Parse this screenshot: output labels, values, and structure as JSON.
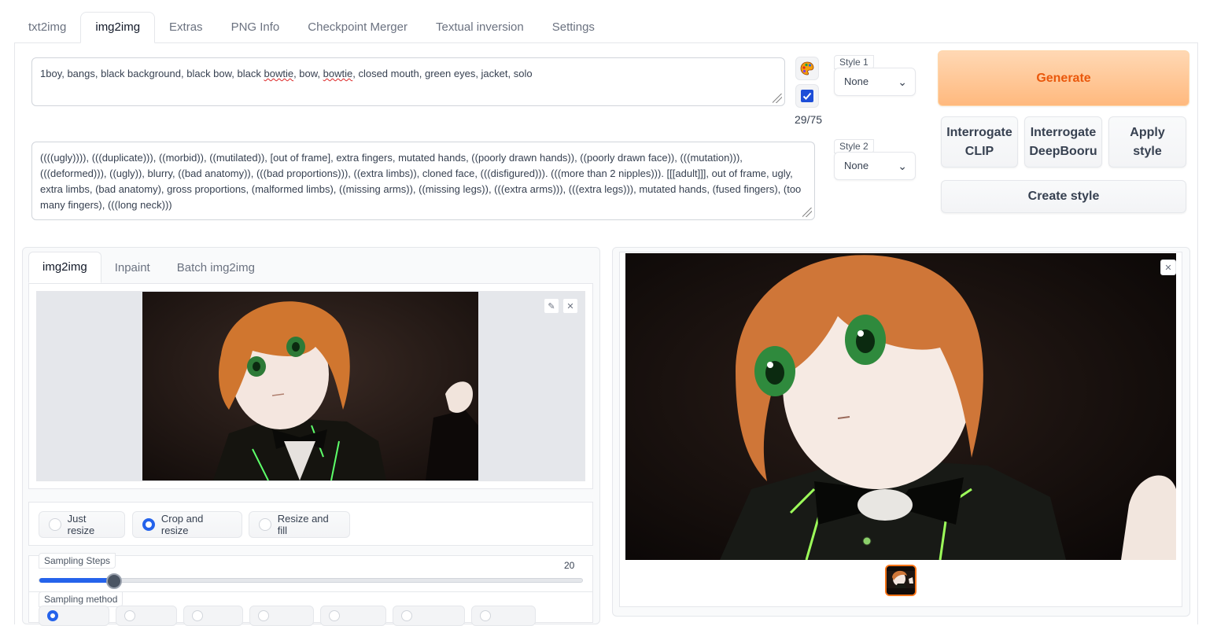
{
  "tabs": [
    "txt2img",
    "img2img",
    "Extras",
    "PNG Info",
    "Checkpoint Merger",
    "Textual inversion",
    "Settings"
  ],
  "prompt": {
    "before1": "1boy, bangs, black background, black bow, black ",
    "word1": "bowtie",
    "between": ", bow, ",
    "word2": "bowtie",
    "after": ", closed mouth, green eyes, jacket, solo"
  },
  "negative_prompt": "((((ugly)))), (((duplicate))), ((morbid)), ((mutilated)), [out of frame], extra fingers, mutated hands, ((poorly drawn hands)), ((poorly drawn face)), (((mutation))), (((deformed))), ((ugly)), blurry, ((bad anatomy)), (((bad proportions))), ((extra limbs)), cloned face, (((disfigured))). (((more than 2 nipples))). [[[adult]]], out of frame, ugly, extra limbs, (bad anatomy), gross proportions, (malformed limbs), ((missing arms)), ((missing legs)), (((extra arms))), (((extra legs))), mutated hands, (fused fingers), (too many fingers), (((long neck)))",
  "token_count": "29/75",
  "icons": {
    "paint": "palette-icon",
    "check": "checkbox-icon"
  },
  "style1": {
    "label": "Style 1",
    "value": "None"
  },
  "style2": {
    "label": "Style 2",
    "value": "None"
  },
  "buttons": {
    "generate": "Generate",
    "interrogate_clip_1": "Interrogate",
    "interrogate_clip_2": "CLIP",
    "interrogate_db_1": "Interrogate",
    "interrogate_db_2": "DeepBooru",
    "apply_style_1": "Apply",
    "apply_style_2": "style",
    "create_style": "Create style"
  },
  "sub_tabs": [
    "img2img",
    "Inpaint",
    "Batch img2img"
  ],
  "resize_modes": [
    "Just resize",
    "Crop and resize",
    "Resize and fill"
  ],
  "selected_resize_mode": "Crop and resize",
  "sampling_steps": {
    "label": "Sampling Steps",
    "value": "20",
    "min": 1,
    "max": 150
  },
  "sampling_method": {
    "label": "Sampling method",
    "selected_index": 0
  },
  "colors": {
    "accent": "#2563eb",
    "generate_text": "#ea580c",
    "thumb_border": "#f97316"
  }
}
